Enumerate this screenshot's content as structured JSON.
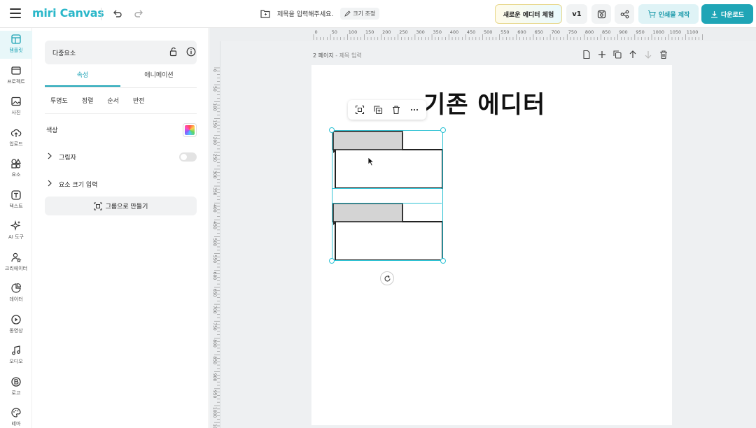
{
  "app": {
    "logo_text": "miri Canvas",
    "doc_title": "제목을 입력해주세요.",
    "resize_label": "크기 조정"
  },
  "header": {
    "new_editor_label": "새로운 에디터 체험",
    "version_label": "v1",
    "print_label": "인쇄물 제작",
    "download_label": "다운로드"
  },
  "leftnav": {
    "items": [
      {
        "label": "템플릿",
        "icon": "template-icon"
      },
      {
        "label": "프로젝트",
        "icon": "project-icon"
      },
      {
        "label": "사진",
        "icon": "photo-icon"
      },
      {
        "label": "업로드",
        "icon": "upload-icon"
      },
      {
        "label": "요소",
        "icon": "elements-icon"
      },
      {
        "label": "텍스트",
        "icon": "text-icon"
      },
      {
        "label": "AI 도구",
        "icon": "ai-tools-icon"
      },
      {
        "label": "크리에이터",
        "icon": "creator-icon"
      },
      {
        "label": "데이터",
        "icon": "data-icon"
      },
      {
        "label": "동영상",
        "icon": "video-icon"
      },
      {
        "label": "오디오",
        "icon": "audio-icon"
      },
      {
        "label": "로고",
        "icon": "logo-icon"
      },
      {
        "label": "테마",
        "icon": "theme-icon"
      }
    ]
  },
  "panel": {
    "selection_name": "다중요소",
    "tabs": [
      "속성",
      "애니메이션"
    ],
    "subtabs": [
      "투명도",
      "정렬",
      "순서",
      "반전"
    ],
    "color_label": "색상",
    "shadow_label": "그림자",
    "size_input_label": "요소 크기 입력",
    "group_button_label": "그룹으로 만들기"
  },
  "canvas": {
    "page_number": "2 페이지",
    "page_title_placeholder": "- 제목 입력",
    "heading_text": "기존 에디터",
    "ruler_top": [
      "0",
      "50",
      "100",
      "150",
      "200",
      "250",
      "300",
      "350",
      "400",
      "450",
      "500",
      "550",
      "600",
      "650",
      "700",
      "750",
      "800",
      "850",
      "900",
      "950",
      "1000",
      "1050",
      "1100"
    ],
    "ruler_left": [
      "0",
      "50",
      "100",
      "150",
      "200",
      "250",
      "300",
      "350",
      "400",
      "450",
      "500",
      "550",
      "600",
      "650",
      "700",
      "750",
      "800",
      "850",
      "900",
      "950",
      "1000",
      "1050"
    ]
  },
  "colors": {
    "accent": "#1fa5b6",
    "selection": "#2ec2d4"
  }
}
